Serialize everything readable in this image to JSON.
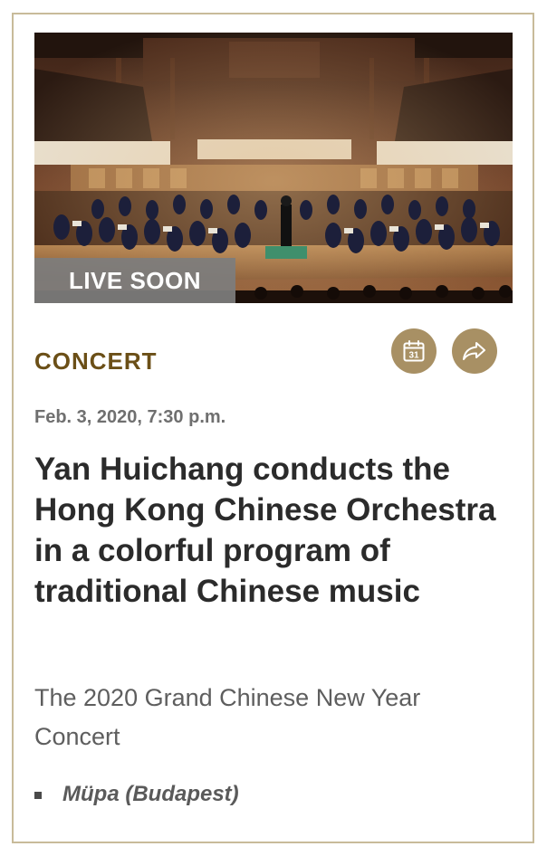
{
  "event": {
    "badge": "LIVE SOON",
    "category": "CONCERT",
    "date": "Feb. 3, 2020, 7:30 p.m.",
    "title": "Yan Huichang conducts the Hong Kong Chinese Orchestra in a colorful program of traditional Chinese music",
    "subtitle": "The 2020 Grand Chinese New Year Concert",
    "venue": "Müpa (Budapest)",
    "calendar_day": "31"
  },
  "icons": {
    "calendar": "calendar-icon",
    "share": "share-icon"
  },
  "colors": {
    "accent": "#a89064",
    "category": "#6b4f17",
    "border": "#c8bb9a",
    "badge_bg": "#7d7d7d"
  }
}
